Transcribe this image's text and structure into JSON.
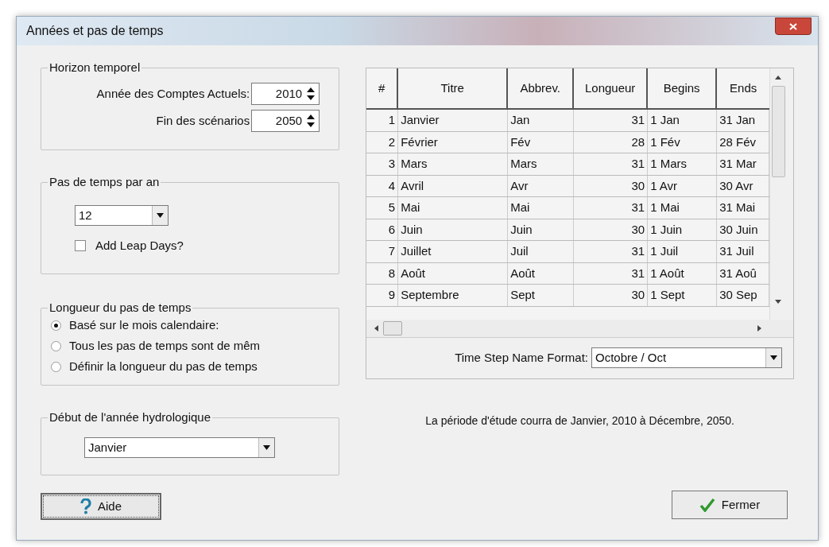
{
  "window": {
    "title": "Années et pas de temps"
  },
  "horizon": {
    "legend": "Horizon temporel",
    "fields": [
      {
        "label": "Année des Comptes Actuels:",
        "value": "2010"
      },
      {
        "label": "Fin des scénarios",
        "value": "2050"
      }
    ]
  },
  "steps_per_year": {
    "legend": "Pas de temps par an",
    "select": {
      "value": "12"
    },
    "leap_days": {
      "label": "Add Leap Days?",
      "checked": false
    }
  },
  "step_length": {
    "legend": "Longueur du pas de temps",
    "options": [
      {
        "label": "Basé sur le mois calendaire:",
        "selected": true
      },
      {
        "label": "Tous les pas de temps sont de mêm",
        "selected": false
      },
      {
        "label": "Définir la longueur du pas de temps",
        "selected": false
      }
    ]
  },
  "hydro_year": {
    "legend": "Début de l'année hydrologique",
    "select": {
      "value": "Janvier"
    }
  },
  "table": {
    "columns": [
      "#",
      "Titre",
      "Abbrev.",
      "Longueur",
      "Begins",
      "Ends"
    ],
    "rows": [
      [
        "1",
        "Janvier",
        "Jan",
        "31",
        "1 Jan",
        "31 Jan"
      ],
      [
        "2",
        "Février",
        "Fév",
        "28",
        "1 Fév",
        "28 Fév"
      ],
      [
        "3",
        "Mars",
        "Mars",
        "31",
        "1 Mars",
        "31 Mar"
      ],
      [
        "4",
        "Avril",
        "Avr",
        "30",
        "1 Avr",
        "30 Avr"
      ],
      [
        "5",
        "Mai",
        "Mai",
        "31",
        "1 Mai",
        "31 Mai"
      ],
      [
        "6",
        "Juin",
        "Juin",
        "30",
        "1 Juin",
        "30 Juin"
      ],
      [
        "7",
        "Juillet",
        "Juil",
        "31",
        "1 Juil",
        "31 Juil"
      ],
      [
        "8",
        "Août",
        "Août",
        "31",
        "1 Août",
        "31 Aoû"
      ],
      [
        "9",
        "Septembre",
        "Sept",
        "30",
        "1 Sept",
        "30 Sep"
      ]
    ]
  },
  "name_format": {
    "label": "Time Step Name Format:",
    "value": "Octobre / Oct"
  },
  "summary": "La période d'étude courra de Janvier, 2010 à Décembre, 2050.",
  "buttons": {
    "help": "Aide",
    "close": "Fermer"
  }
}
